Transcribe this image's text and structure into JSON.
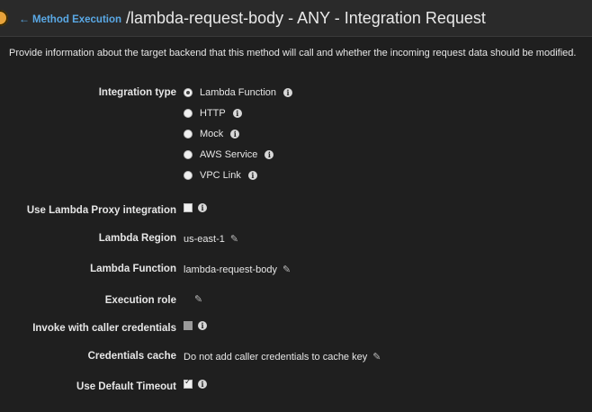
{
  "header": {
    "back_label": "Method Execution",
    "back_arrow": "←",
    "title": "/lambda-request-body - ANY - Integration Request"
  },
  "description": "Provide information about the target backend that this method will call and whether the incoming request data should be modified.",
  "integration_type": {
    "label": "Integration type",
    "options": [
      {
        "label": "Lambda Function",
        "selected": true
      },
      {
        "label": "HTTP",
        "selected": false
      },
      {
        "label": "Mock",
        "selected": false
      },
      {
        "label": "AWS Service",
        "selected": false
      },
      {
        "label": "VPC Link",
        "selected": false
      }
    ]
  },
  "proxy": {
    "label": "Use Lambda Proxy integration",
    "checked": false
  },
  "region": {
    "label": "Lambda Region",
    "value": "us-east-1"
  },
  "function": {
    "label": "Lambda Function",
    "value": "lambda-request-body"
  },
  "role": {
    "label": "Execution role",
    "value": ""
  },
  "caller_creds": {
    "label": "Invoke with caller credentials",
    "checked": false,
    "disabled": true
  },
  "creds_cache": {
    "label": "Credentials cache",
    "value": "Do not add caller credentials to cache key"
  },
  "default_timeout": {
    "label": "Use Default Timeout",
    "checked": true
  },
  "icons": {
    "info": "info-icon",
    "edit": "pencil-icon",
    "warning": "warning-icon"
  },
  "colors": {
    "background": "#1f1f1f",
    "link": "#5aa9e6",
    "warning": "#e8a33a"
  }
}
